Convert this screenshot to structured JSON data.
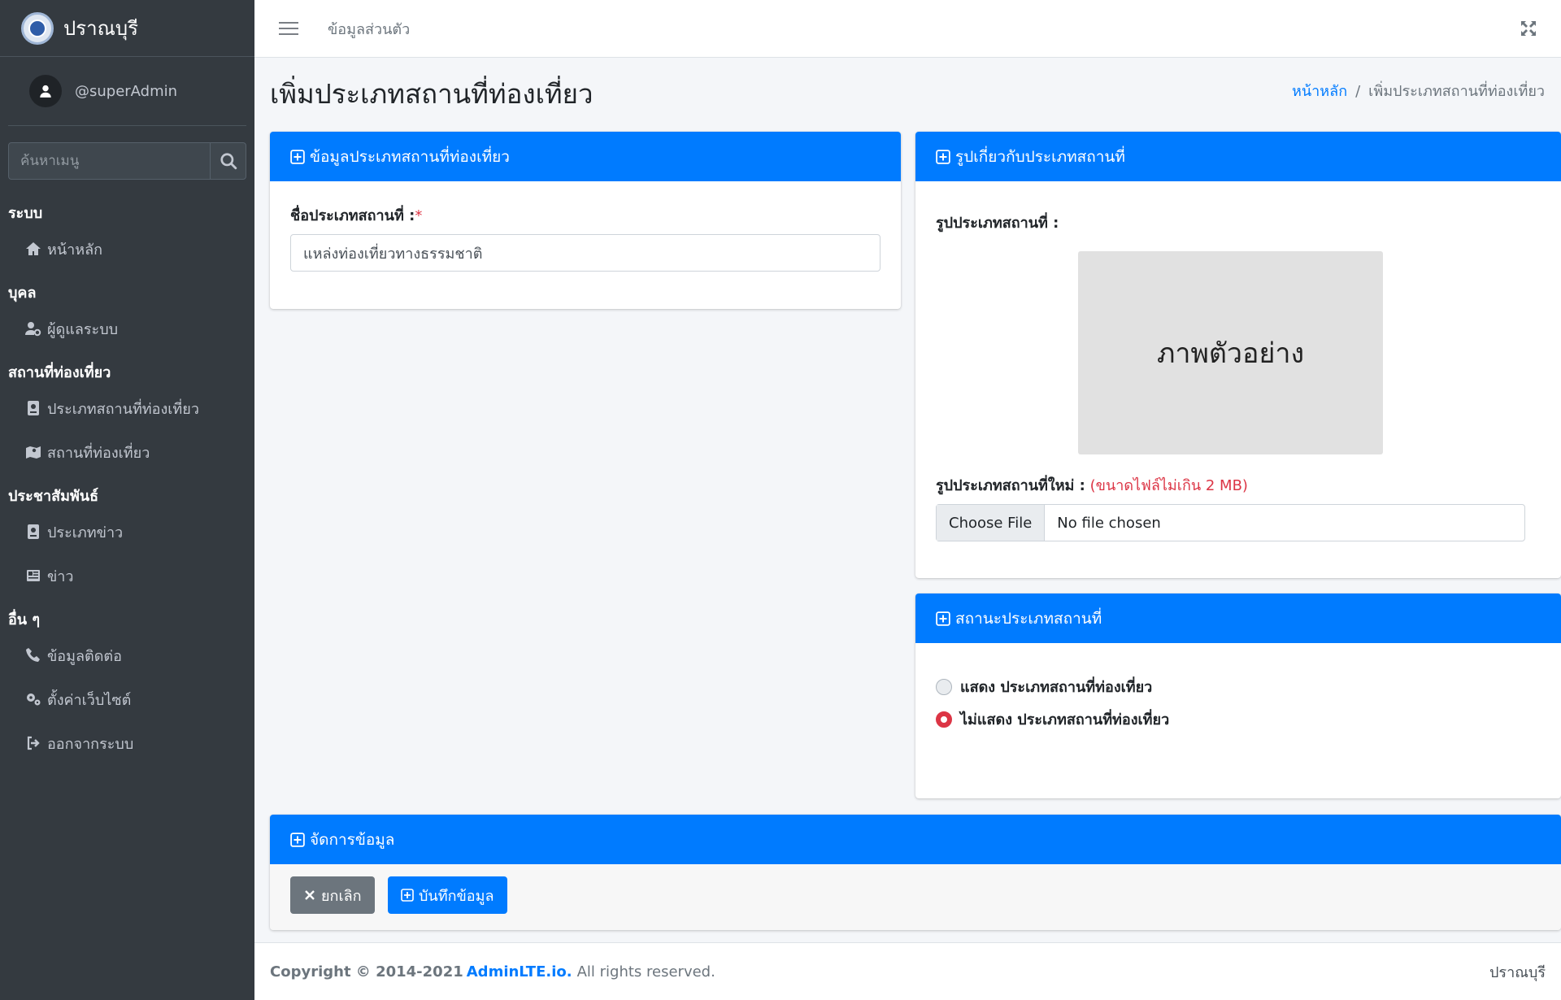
{
  "brand": {
    "name": "ปราณบุรี"
  },
  "user": {
    "name": "@superAdmin"
  },
  "sidebar": {
    "search_placeholder": "ค้นหาเมนู",
    "sections": [
      {
        "header": "ระบบ",
        "items": [
          {
            "label": "หน้าหลัก",
            "icon": "home-icon"
          }
        ]
      },
      {
        "header": "บุคล",
        "items": [
          {
            "label": "ผู้ดูแลระบบ",
            "icon": "user-cog-icon"
          }
        ]
      },
      {
        "header": "สถานที่ท่องเที่ยว",
        "items": [
          {
            "label": "ประเภทสถานที่ท่องเที่ยว",
            "icon": "book-icon"
          },
          {
            "label": "สถานที่ท่องเที่ยว",
            "icon": "map-icon"
          }
        ]
      },
      {
        "header": "ประชาสัมพันธ์",
        "items": [
          {
            "label": "ประเภทข่าว",
            "icon": "book-icon"
          },
          {
            "label": "ข่าว",
            "icon": "newspaper-icon"
          }
        ]
      },
      {
        "header": "อื่น ๆ",
        "items": [
          {
            "label": "ข้อมูลติดต่อ",
            "icon": "phone-icon"
          },
          {
            "label": "ตั้งค่าเว็บไซต์",
            "icon": "gears-icon"
          },
          {
            "label": "ออกจากระบบ",
            "icon": "sign-out-icon"
          }
        ]
      }
    ]
  },
  "topbar": {
    "link": "ข้อมูลส่วนตัว"
  },
  "page": {
    "title": "เพิ่มประเภทสถานที่ท่องเที่ยว",
    "breadcrumb_home": "หน้าหลัก",
    "breadcrumb_sep": "/",
    "breadcrumb_current": "เพิ่มประเภทสถานที่ท่องเที่ยว"
  },
  "info_card": {
    "title": "ข้อมูลประเภทสถานที่ท่องเที่ยว",
    "name_label": "ชื่อประเภทสถานที่ :",
    "required_mark": "*",
    "name_value": "แหล่งท่องเที่ยวทางธรรมชาติ"
  },
  "image_card": {
    "title": "รูปเกี่ยวกับประเภทสถานที่",
    "current_label": "รูปประเภทสถานที่ :",
    "preview_text": "ภาพตัวอย่าง",
    "new_label": "รูปประเภทสถานที่ใหม่ :",
    "size_note": "(ขนาดไฟล์ไม่เกิน 2 MB)",
    "choose_file": "Choose File",
    "no_file": "No file chosen"
  },
  "status_card": {
    "title": "สถานะประเภทสถานที่",
    "option_show": "แสดง ประเภทสถานที่ท่องเที่ยว",
    "option_hide": "ไม่แสดง ประเภทสถานที่ท่องเที่ยว",
    "selected": "option_hide"
  },
  "manage_card": {
    "title": "จัดการข้อมูล",
    "cancel": "ยกเลิก",
    "save": "บันทึกข้อมูล"
  },
  "footer": {
    "copyright": "Copyright © 2014-2021",
    "brand_link": "AdminLTE.io.",
    "rights": "All rights reserved.",
    "right": "ปราณบุรี"
  },
  "colors": {
    "primary": "#007bff",
    "sidebar": "#343a40",
    "danger": "#dc3545",
    "secondary": "#6c757d"
  }
}
